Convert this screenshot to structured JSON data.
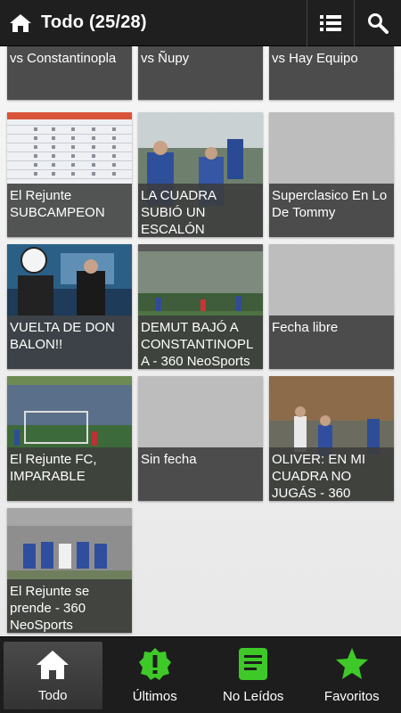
{
  "header": {
    "title": "Todo (25/28)",
    "icons": {
      "home": "home-icon",
      "list": "list-icon",
      "search": "search-icon"
    }
  },
  "tiles": [
    {
      "caption": "vs Constantinopla",
      "thumb": "none"
    },
    {
      "caption": "vs Ñupy",
      "thumb": "none"
    },
    {
      "caption": "vs Hay Equipo",
      "thumb": "none"
    },
    {
      "caption": "El Rejunte SUBCAMPEON",
      "thumb": "table-image"
    },
    {
      "caption": "LA CUADRA SUBIÓ UN ESCALÓN",
      "thumb": "players-photo"
    },
    {
      "caption": "Superclasico En Lo De Tommy",
      "thumb": "none"
    },
    {
      "caption": "VUELTA DE DON BALON!!",
      "thumb": "tv-studio-photo"
    },
    {
      "caption": "DEMUT BAJÓ A CONSTANTINOPLA - 360 NeoSports",
      "thumb": "field-photo"
    },
    {
      "caption": "Fecha libre",
      "thumb": "none"
    },
    {
      "caption": "El Rejunte FC, IMPARABLE",
      "thumb": "goal-photo"
    },
    {
      "caption": "Sin fecha",
      "thumb": "none"
    },
    {
      "caption": "OLIVER: EN MI CUADRA NO JUGÁS - 360",
      "thumb": "match-photo"
    },
    {
      "caption": "El Rejunte se prende - 360 NeoSports",
      "thumb": "team-photo"
    }
  ],
  "tabs": [
    {
      "label": "Todo",
      "icon": "home-icon",
      "active": true
    },
    {
      "label": "Últimos",
      "icon": "alert-badge-icon",
      "active": false
    },
    {
      "label": "No Leídos",
      "icon": "document-icon",
      "active": false
    },
    {
      "label": "Favoritos",
      "icon": "star-icon",
      "active": false
    }
  ],
  "colors": {
    "accent": "#3ec928",
    "bar": "#1f1f1f",
    "caption": "#3c3c3c"
  }
}
